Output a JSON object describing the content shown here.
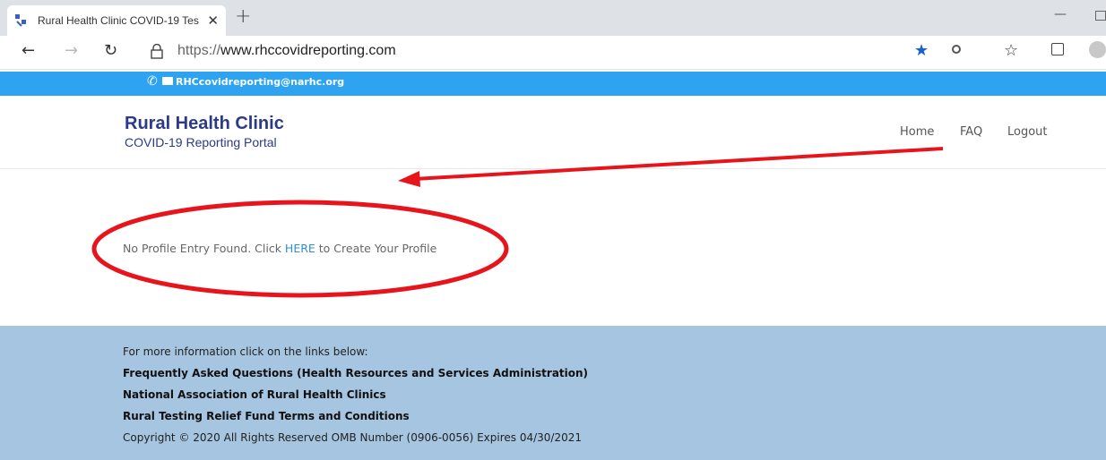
{
  "browser": {
    "tab_title": "Rural Health Clinic COVID-19 Tes",
    "tab_close": "✕",
    "new_tab": "+",
    "url_scheme": "https://",
    "url_host": "www.rhccovidreporting.com",
    "window_min": "—",
    "toolbar_icons": [
      "back-icon",
      "forward-icon",
      "refresh-icon",
      "lock-icon",
      "favorite-star-icon",
      "extension-icon",
      "favorites-icon",
      "collections-icon",
      "profile-icon"
    ]
  },
  "topbar": {
    "email": "RHCcovidreporting@narhc.org",
    "color": "#2ea3f2"
  },
  "header": {
    "title": "Rural Health Clinic",
    "subtitle": "COVID-19 Reporting Portal",
    "nav": {
      "home": "Home",
      "faq": "FAQ",
      "logout": "Logout"
    }
  },
  "main": {
    "message_before": "No Profile Entry Found. Click ",
    "link": "HERE",
    "message_after": " to Create Your Profile"
  },
  "footer": {
    "intro": "For more information click on the links below:",
    "links": [
      "Frequently Asked Questions (Health Resources and Services Administration)",
      "National Association of Rural Health Clinics",
      "Rural Testing Relief Fund Terms and Conditions"
    ],
    "copyright": "Copyright © 2020 All Rights Reserved OMB Number (0906-0056) Expires 04/30/2021",
    "background": "#a6c5e0"
  },
  "annotation": {
    "color": "#e8141c"
  }
}
